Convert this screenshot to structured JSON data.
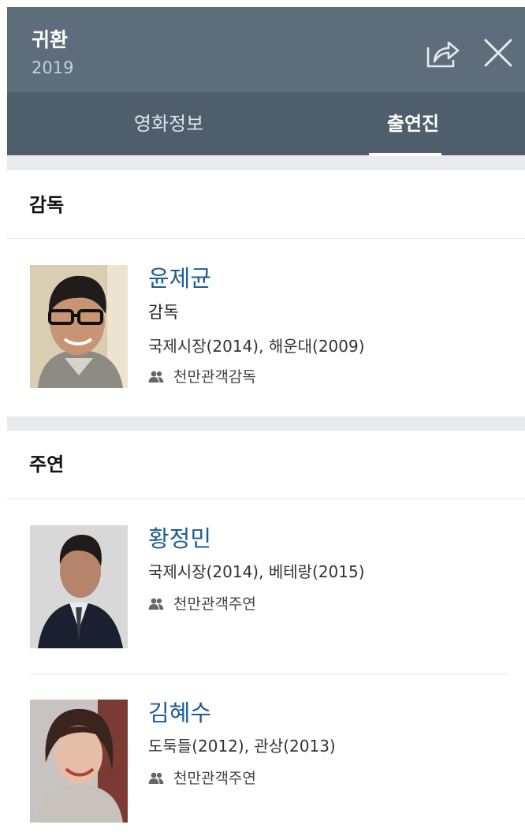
{
  "header": {
    "title": "귀환",
    "year": "2019"
  },
  "tabs": [
    {
      "label": "영화정보",
      "active": false
    },
    {
      "label": "출연진",
      "active": true
    }
  ],
  "sections": {
    "director": {
      "title": "감독",
      "people": [
        {
          "name": "윤제균",
          "role": "감독",
          "works": "국제시장(2014), 해운대(2009)",
          "badge": "천만관객감독"
        }
      ]
    },
    "main_cast": {
      "title": "주연",
      "people": [
        {
          "name": "황정민",
          "works": "국제시장(2014), 베테랑(2015)",
          "badge": "천만관객주연"
        },
        {
          "name": "김혜수",
          "works": "도둑들(2012), 관상(2013)",
          "badge": "천만관객주연"
        }
      ]
    }
  },
  "colors": {
    "header_bg": "#5d6d7c",
    "tabs_bg": "#4f5e6d",
    "name_link": "#1d5d96"
  },
  "icons": [
    "share-icon",
    "close-icon",
    "people-icon"
  ]
}
